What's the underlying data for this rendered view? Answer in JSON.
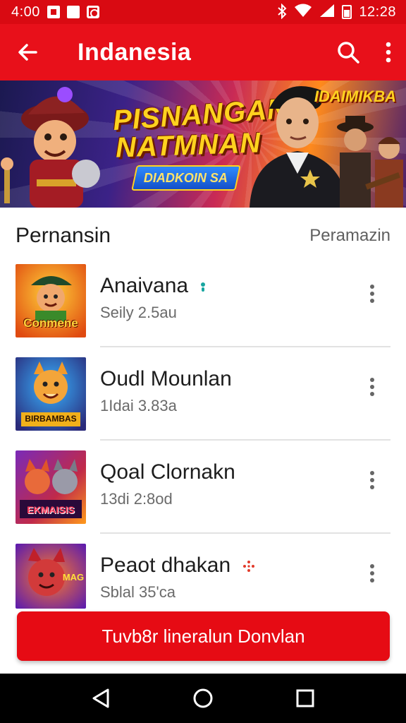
{
  "status_bar": {
    "time": "4:00",
    "clock": "12:28",
    "icons": [
      "notification-icon",
      "photo-icon",
      "camera-icon",
      "bluetooth-icon",
      "wifi-icon",
      "signal-icon",
      "battery-icon"
    ]
  },
  "app_bar": {
    "title": "Indanesia",
    "icons": [
      "back-arrow-icon",
      "search-icon",
      "more-vert-icon"
    ]
  },
  "banner": {
    "headline_line1": "PISNANGAN!",
    "headline_line2": "NATMNAN",
    "pill_text": "DIADKOIN SA",
    "corner_text": "IDAIMIKBA"
  },
  "section": {
    "title": "Pernansin",
    "link": "Peramazin"
  },
  "items": [
    {
      "title": "Anaivana",
      "subtitle": "Seily 2.5au",
      "thumb_label": "Conmene",
      "badge": "teal-dot-icon"
    },
    {
      "title": "Oudl Mounlan",
      "subtitle": "1Idai 3.83a",
      "thumb_label": "BIRBAMBAS",
      "badge": ""
    },
    {
      "title": "Qoal Clornakn",
      "subtitle": "13di 2:8od",
      "thumb_label": "EKMAISIS",
      "badge": ""
    },
    {
      "title": "Peaot dhakan",
      "subtitle": "Sblal 35'ca",
      "thumb_label": "MAG",
      "badge": "red-sparkle-icon"
    }
  ],
  "cta": {
    "label": "Tuvb8r lineralun Donvlan"
  },
  "nav": {
    "icons": [
      "back-triangle-icon",
      "home-circle-icon",
      "recents-square-icon"
    ]
  },
  "colors": {
    "primary": "#e8101a",
    "status_bar": "#d90a12",
    "cta": "#e60b14",
    "nav_bar": "#000000"
  }
}
